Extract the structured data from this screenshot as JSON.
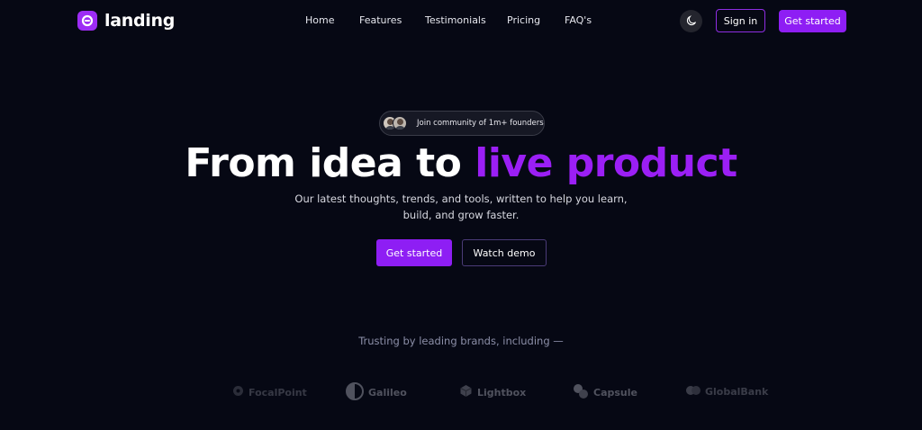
{
  "header": {
    "logo_text": "landing",
    "nav": [
      "Home",
      "Features",
      "Testimonials",
      "Pricing",
      "FAQ's"
    ],
    "theme_icon": "moon-icon",
    "signin_label": "Sign in",
    "get_started_label": "Get started"
  },
  "hero": {
    "badge_text": "Join community of 1m+ founders",
    "headline_main": "From idea to ",
    "headline_accent": "live product",
    "subtitle_line1": "Our latest thoughts, trends, and tools, written to help you learn,",
    "subtitle_line2": "build, and grow faster.",
    "primary_button": "Get started",
    "secondary_button": "Watch demo"
  },
  "brands": {
    "heading": "Trusting by leading brands, including —",
    "items": [
      "FocalPoint",
      "Galileo",
      "Lightbox",
      "Capsule",
      "GlobalBank"
    ]
  },
  "colors": {
    "background": "#060814",
    "accent": "#8e1ef4",
    "accent_text": "#9b1ff5"
  }
}
